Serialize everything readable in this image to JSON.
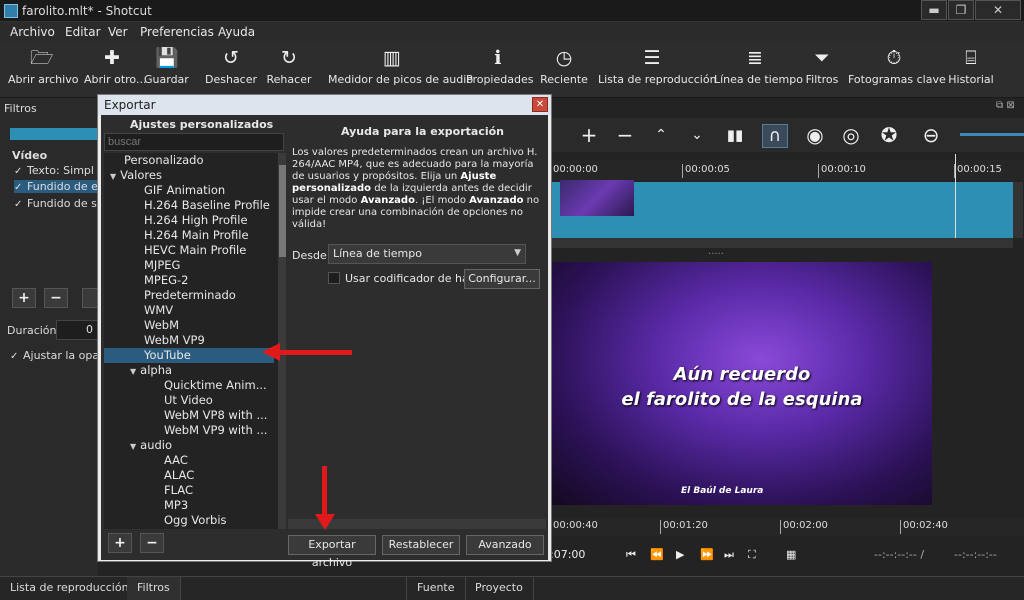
{
  "window": {
    "title": "farolito.mlt* - Shotcut",
    "min": "▬",
    "restore": "❐",
    "close": "✕"
  },
  "menu": [
    "Archivo",
    "Editar",
    "Ver",
    "Preferencias",
    "Ayuda"
  ],
  "toolbar": [
    {
      "label": "Abrir archivo",
      "icon": "folder-icon"
    },
    {
      "label": "Abrir otro...",
      "icon": "add-icon"
    },
    {
      "label": "Guardar",
      "icon": "save-icon"
    },
    {
      "label": "Deshacer",
      "icon": "undo-icon"
    },
    {
      "label": "Rehacer",
      "icon": "redo-icon"
    },
    {
      "label": "Medidor de picos de audio",
      "icon": "meter-icon"
    },
    {
      "label": "Propiedades",
      "icon": "info-icon"
    },
    {
      "label": "Reciente",
      "icon": "clock-icon"
    },
    {
      "label": "Lista de reproducción",
      "icon": "list-icon"
    },
    {
      "label": "Línea de tiempo",
      "icon": "timeline-icon"
    },
    {
      "label": "Filtros",
      "icon": "filter-icon"
    },
    {
      "label": "Fotogramas clave",
      "icon": "stopwatch-icon"
    },
    {
      "label": "Historial",
      "icon": "history-icon"
    }
  ],
  "filters_panel": {
    "title": "Filtros",
    "section": "Vídeo",
    "items": [
      "Texto: Simpl",
      "Fundido de e",
      "Fundido de s"
    ],
    "duration_label": "Duración",
    "duration_value": "0",
    "adjust_label": "Ajustar la opac"
  },
  "timeline": {
    "ticks": [
      "00:00:00",
      "00:00:05",
      "00:00:10",
      "00:00:15"
    ],
    "dots": "....."
  },
  "video": {
    "line1": "Aún recuerdo",
    "line2": "el farolito de la esquina",
    "credit": "El Baúl de Laura"
  },
  "player": {
    "ticks": [
      "00:00:40",
      "00:01:20",
      "00:02:00",
      "00:02:40"
    ],
    "time_left": ":07:00",
    "time_in": "--:--:--:-- /",
    "time_out": "--:--:--:--"
  },
  "bottom_tabs": [
    "Lista de reproducción",
    "Filtros",
    "Fuente",
    "Proyecto"
  ],
  "dialog": {
    "title": "Exportar",
    "presets_heading": "Ajustes personalizados",
    "search_placeholder": "buscar",
    "presets": [
      {
        "label": "Personalizado",
        "level": 0
      },
      {
        "label": "Valores",
        "level": 0,
        "expanded": true
      },
      {
        "label": "GIF Animation",
        "level": 1
      },
      {
        "label": "H.264 Baseline Profile",
        "level": 1
      },
      {
        "label": "H.264 High Profile",
        "level": 1
      },
      {
        "label": "H.264 Main Profile",
        "level": 1
      },
      {
        "label": "HEVC Main Profile",
        "level": 1
      },
      {
        "label": "MJPEG",
        "level": 1
      },
      {
        "label": "MPEG-2",
        "level": 1
      },
      {
        "label": "Predeterminado",
        "level": 1
      },
      {
        "label": "WMV",
        "level": 1
      },
      {
        "label": "WebM",
        "level": 1
      },
      {
        "label": "WebM VP9",
        "level": 1
      },
      {
        "label": "YouTube",
        "level": 1,
        "selected": true
      },
      {
        "label": "alpha",
        "level": 1,
        "expanded": true
      },
      {
        "label": "Quicktime Anim...",
        "level": 2
      },
      {
        "label": "Ut Video",
        "level": 2
      },
      {
        "label": "WebM VP8 with ...",
        "level": 2
      },
      {
        "label": "WebM VP9 with ...",
        "level": 2
      },
      {
        "label": "audio",
        "level": 1,
        "expanded": true
      },
      {
        "label": "AAC",
        "level": 2
      },
      {
        "label": "ALAC",
        "level": 2
      },
      {
        "label": "FLAC",
        "level": 2
      },
      {
        "label": "MP3",
        "level": 2
      },
      {
        "label": "Ogg Vorbis",
        "level": 2
      }
    ],
    "help_heading": "Ayuda para la exportación",
    "help_p1": "Los valores predeterminados crean un archivo H. 264/AAC MP4, que es adecuado para la mayoría de usuarios y propósitos. Elija un ",
    "help_b1": "Ajuste personalizado",
    "help_p2": " de la izquierda antes de decidir usar el modo ",
    "help_b2": "Avanzado",
    "help_p3": ". ¡El modo ",
    "help_b3": "Avanzado",
    "help_p4": " no impide crear una combinación de opciones no válida!",
    "desde_label": "Desde",
    "desde_value": "Línea de tiempo",
    "hw_label": "Usar codificador de har",
    "configure_label": "Configurar...",
    "export_label": "Exportar archivo",
    "reset_label": "Restablecer",
    "advanced_label": "Avanzado",
    "add_label": "+",
    "remove_label": "−"
  },
  "colors": {
    "accent": "#2e8fb5",
    "selection": "#2a5c80",
    "arrow": "#e0191b"
  }
}
